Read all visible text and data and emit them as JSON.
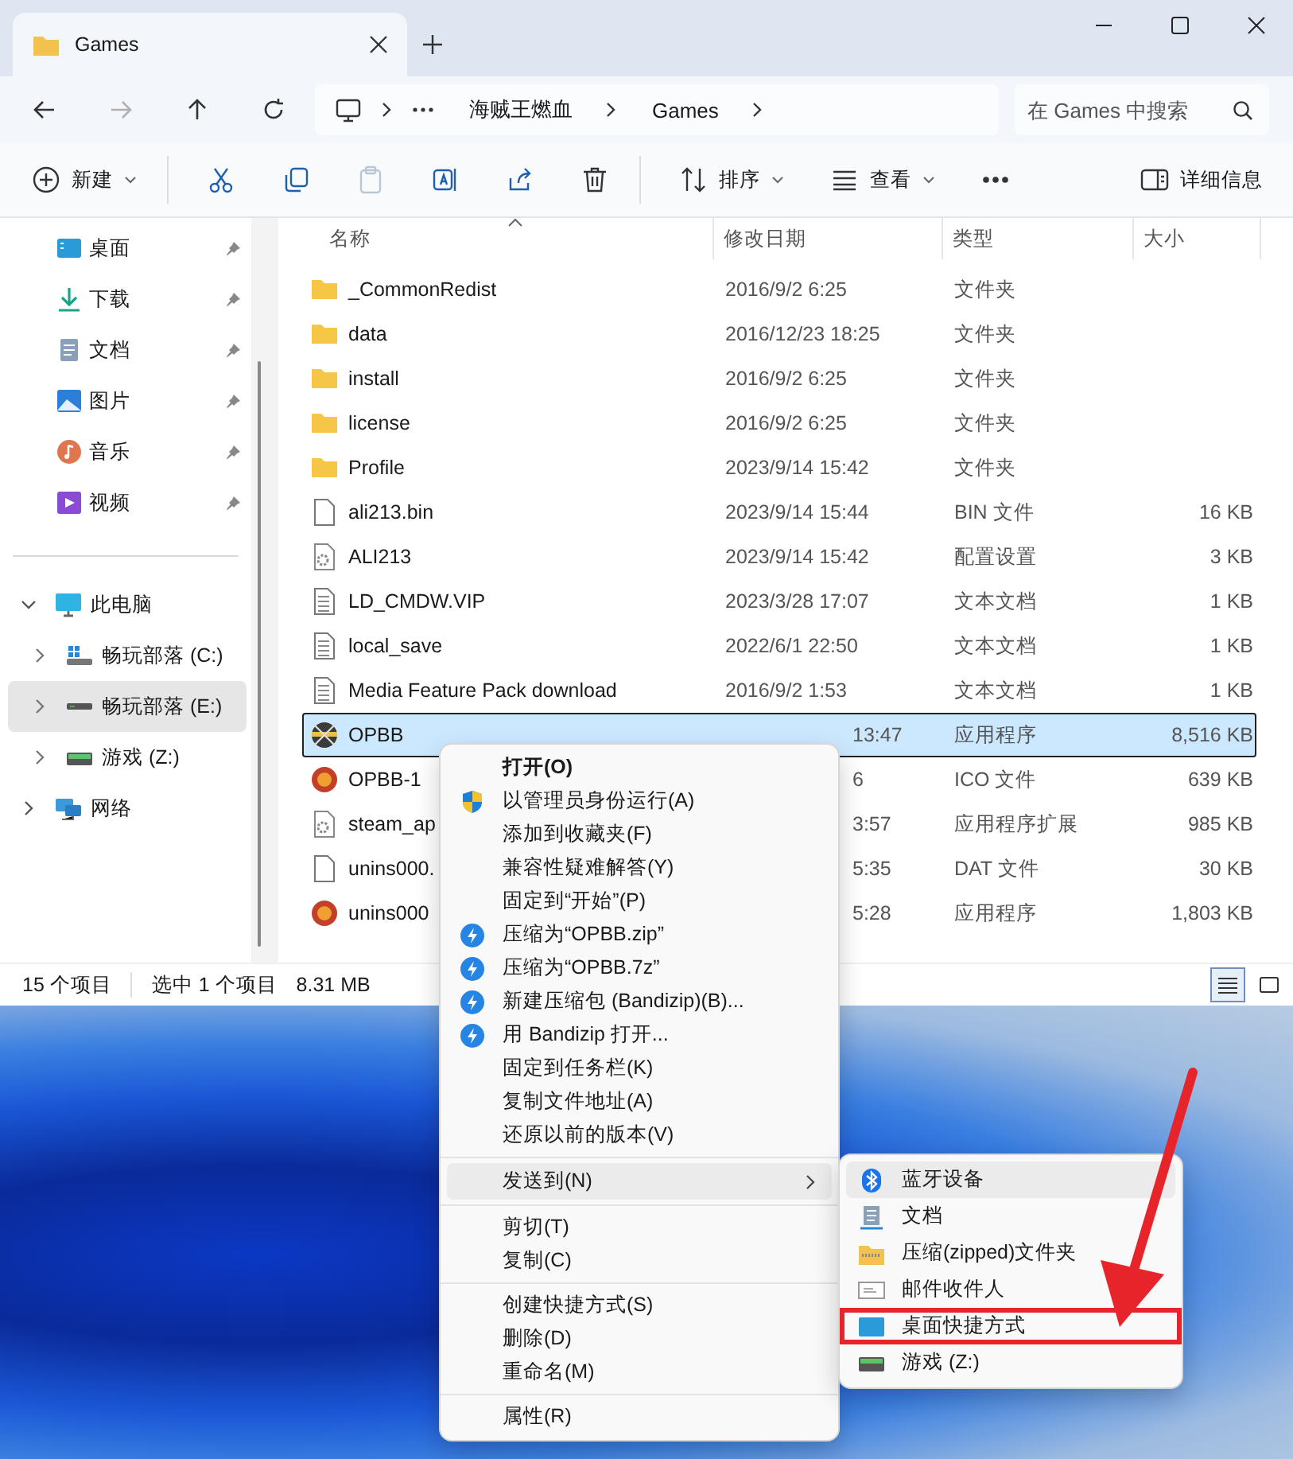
{
  "window": {
    "tab_title": "Games"
  },
  "navigation": {
    "buttons": [
      {
        "kind": "back",
        "disabled": false
      },
      {
        "kind": "forward",
        "disabled": true
      },
      {
        "kind": "up",
        "disabled": false
      },
      {
        "kind": "refresh",
        "disabled": false
      }
    ],
    "path": [
      "海贼王燃血",
      "Games"
    ],
    "search": {
      "placeholder": "在 Games 中搜索"
    }
  },
  "toolbar": [
    {
      "kind": "new",
      "label": "新建",
      "dropdown": true,
      "disabled": false
    },
    {
      "kind": "cut",
      "disabled": false
    },
    {
      "kind": "copy",
      "disabled": false
    },
    {
      "kind": "paste",
      "disabled": true
    },
    {
      "kind": "rename",
      "disabled": false
    },
    {
      "kind": "share",
      "disabled": false
    },
    {
      "kind": "delete",
      "disabled": false
    },
    {
      "kind": "sort",
      "label": "排序",
      "dropdown": true,
      "disabled": false
    },
    {
      "kind": "view",
      "label": "查看",
      "dropdown": true,
      "disabled": false
    },
    {
      "kind": "more",
      "disabled": false
    },
    {
      "kind": "details",
      "label": "详细信息",
      "disabled": false
    }
  ],
  "sidebar": {
    "quick_access": [
      {
        "label": "桌面",
        "kind": "desktop",
        "pinned": true
      },
      {
        "label": "下载",
        "kind": "download",
        "pinned": true
      },
      {
        "label": "文档",
        "kind": "documents",
        "pinned": true
      },
      {
        "label": "图片",
        "kind": "pictures",
        "pinned": true
      },
      {
        "label": "音乐",
        "kind": "music",
        "pinned": true
      },
      {
        "label": "视频",
        "kind": "video",
        "pinned": true
      }
    ],
    "tree": [
      {
        "label": "此电脑",
        "kind": "pc",
        "expanded": true,
        "selected": false,
        "children": [
          {
            "label": "畅玩部落 (C:)",
            "kind": "windrive",
            "expanded": false,
            "selected": false
          },
          {
            "label": "畅玩部落 (E:)",
            "kind": "drive",
            "expanded": false,
            "selected": true
          },
          {
            "label": "游戏 (Z:)",
            "kind": "gamedrive",
            "expanded": false,
            "selected": false
          }
        ]
      },
      {
        "label": "网络",
        "kind": "network",
        "expanded": false,
        "selected": false
      }
    ]
  },
  "file_list": {
    "columns": [
      {
        "label": "名称",
        "sorted": true
      },
      {
        "label": "修改日期",
        "sorted": false
      },
      {
        "label": "类型",
        "sorted": false
      },
      {
        "label": "大小",
        "sorted": false
      }
    ],
    "rows": [
      {
        "name": "_CommonRedist",
        "date": "2016/9/2 6:25",
        "type": "文件夹",
        "kind": "folder",
        "selected": false,
        "covered": false
      },
      {
        "name": "data",
        "date": "2016/12/23 18:25",
        "type": "文件夹",
        "kind": "folder",
        "selected": false,
        "covered": false
      },
      {
        "name": "install",
        "date": "2016/9/2 6:25",
        "type": "文件夹",
        "kind": "folder",
        "selected": false,
        "covered": false
      },
      {
        "name": "license",
        "date": "2016/9/2 6:25",
        "type": "文件夹",
        "kind": "folder",
        "selected": false,
        "covered": false
      },
      {
        "name": "Profile",
        "date": "2023/9/14 15:42",
        "type": "文件夹",
        "kind": "folder",
        "selected": false,
        "covered": false
      },
      {
        "name": "ali213.bin",
        "date": "2023/9/14 15:44",
        "type": "BIN 文件",
        "size": "16 KB",
        "kind": "file",
        "selected": false,
        "covered": false
      },
      {
        "name": "ALI213",
        "date": "2023/9/14 15:42",
        "type": "配置设置",
        "size": "3 KB",
        "kind": "settings",
        "selected": false,
        "covered": false
      },
      {
        "name": "LD_CMDW.VIP",
        "date": "2023/3/28 17:07",
        "type": "文本文档",
        "size": "1 KB",
        "kind": "text",
        "selected": false,
        "covered": false
      },
      {
        "name": "local_save",
        "date": "2022/6/1 22:50",
        "type": "文本文档",
        "size": "1 KB",
        "kind": "text",
        "selected": false,
        "covered": false
      },
      {
        "name": "Media Feature Pack download",
        "date": "2016/9/2 1:53",
        "type": "文本文档",
        "size": "1 KB",
        "kind": "text",
        "selected": false,
        "covered": false
      },
      {
        "name": "OPBB",
        "date": "13:47",
        "type": "应用程序",
        "size": "8,516 KB",
        "kind": "exe",
        "selected": true,
        "covered": true
      },
      {
        "name": "OPBB-1",
        "date": "6",
        "type": "ICO 文件",
        "size": "639 KB",
        "kind": "ico",
        "selected": false,
        "covered": true
      },
      {
        "name": "steam_ap",
        "date": "3:57",
        "type": "应用程序扩展",
        "size": "985 KB",
        "kind": "settings",
        "selected": false,
        "covered": true
      },
      {
        "name": "unins000.",
        "date": "5:35",
        "type": "DAT 文件",
        "size": "30 KB",
        "kind": "file",
        "selected": false,
        "covered": true
      },
      {
        "name": "unins000",
        "date": "5:28",
        "type": "应用程序",
        "size": "1,803 KB",
        "kind": "ico",
        "selected": false,
        "covered": true
      }
    ]
  },
  "status_bar": {
    "count": "15 个项目",
    "selection": "选中 1 个项目",
    "selection_size": "8.31 MB",
    "views": [
      {
        "kind": "details",
        "selected": true
      },
      {
        "kind": "tiles",
        "selected": false
      }
    ]
  },
  "context_menu": [
    {
      "kind": "default",
      "label": "打开(O)",
      "selected": false
    },
    {
      "kind": "shield",
      "label": "以管理员身份运行(A)",
      "selected": false
    },
    {
      "kind": "plain",
      "label": "添加到收藏夹(F)",
      "selected": false
    },
    {
      "kind": "plain",
      "label": "兼容性疑难解答(Y)",
      "selected": false
    },
    {
      "kind": "plain",
      "label": "固定到“开始”(P)",
      "selected": false
    },
    {
      "kind": "bandizip",
      "label": "压缩为“OPBB.zip”",
      "selected": false
    },
    {
      "kind": "bandizip",
      "label": "压缩为“OPBB.7z”",
      "selected": false
    },
    {
      "kind": "bandizip",
      "label": "新建压缩包 (Bandizip)(B)...",
      "selected": false
    },
    {
      "kind": "bandizip",
      "label": "用 Bandizip 打开...",
      "selected": false
    },
    {
      "kind": "plain",
      "label": "固定到任务栏(K)",
      "selected": false
    },
    {
      "kind": "plain",
      "label": "复制文件地址(A)",
      "selected": false
    },
    {
      "kind": "plain",
      "label": "还原以前的版本(V)",
      "selected": false
    },
    {
      "kind": "separator"
    },
    {
      "kind": "submenu",
      "label": "发送到(N)",
      "selected": true
    },
    {
      "kind": "separator"
    },
    {
      "kind": "plain",
      "label": "剪切(T)",
      "selected": false
    },
    {
      "kind": "plain",
      "label": "复制(C)",
      "selected": false
    },
    {
      "kind": "separator"
    },
    {
      "kind": "plain",
      "label": "创建快捷方式(S)",
      "selected": false
    },
    {
      "kind": "plain",
      "label": "删除(D)",
      "selected": false
    },
    {
      "kind": "plain",
      "label": "重命名(M)",
      "selected": false
    },
    {
      "kind": "separator"
    },
    {
      "kind": "plain",
      "label": "属性(R)",
      "selected": false
    }
  ],
  "send_to_menu": [
    {
      "kind": "bluetooth",
      "label": "蓝牙设备",
      "selected": true,
      "annotated": false
    },
    {
      "kind": "documents",
      "label": "文档",
      "selected": false,
      "annotated": false
    },
    {
      "kind": "zip",
      "label": "压缩(zipped)文件夹",
      "selected": false,
      "annotated": false
    },
    {
      "kind": "mail",
      "label": "邮件收件人",
      "selected": false,
      "annotated": false
    },
    {
      "kind": "desktop",
      "label": "桌面快捷方式",
      "selected": false,
      "annotated": true
    },
    {
      "kind": "gamedrive",
      "label": "游戏 (Z:)",
      "selected": false,
      "annotated": false
    }
  ]
}
